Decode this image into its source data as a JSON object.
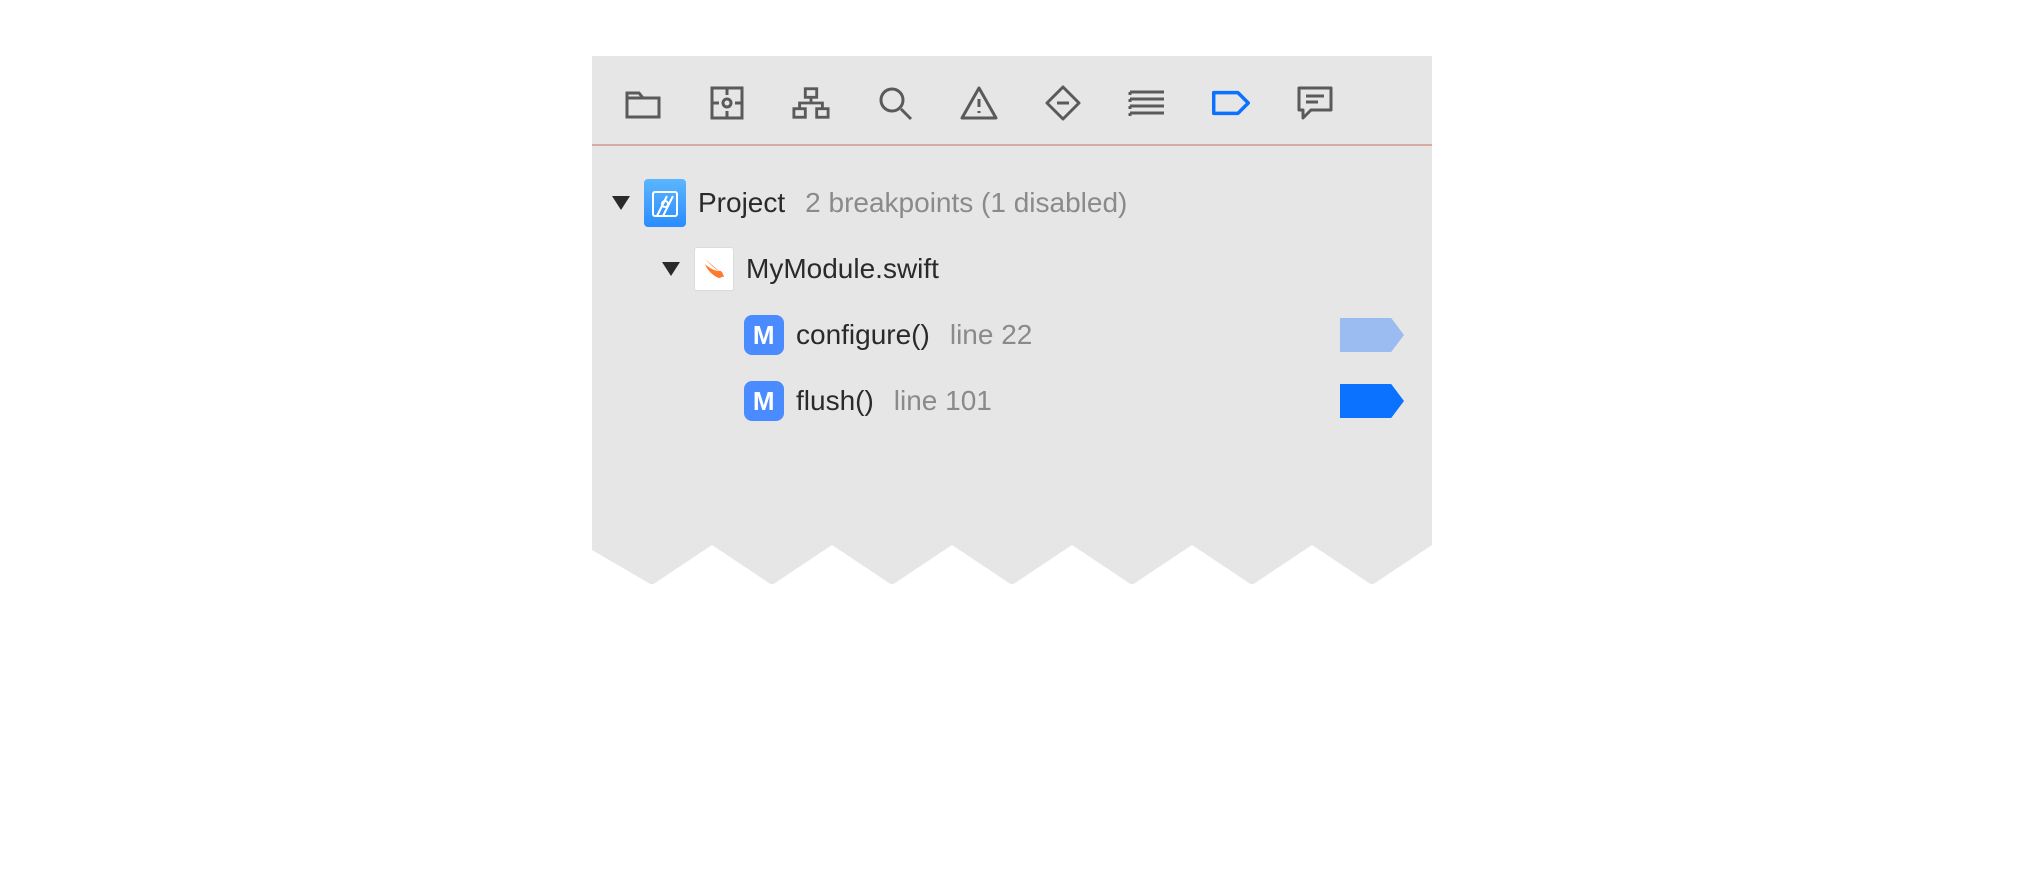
{
  "toolbar": {
    "tabs": [
      {
        "name": "project-navigator-tab",
        "icon": "folder"
      },
      {
        "name": "source-control-navigator-tab",
        "icon": "scm"
      },
      {
        "name": "symbol-navigator-tab",
        "icon": "hierarchy"
      },
      {
        "name": "find-navigator-tab",
        "icon": "search"
      },
      {
        "name": "issue-navigator-tab",
        "icon": "warning"
      },
      {
        "name": "test-navigator-tab",
        "icon": "diamond"
      },
      {
        "name": "debug-navigator-tab",
        "icon": "gauge"
      },
      {
        "name": "breakpoint-navigator-tab",
        "icon": "tag",
        "active": true
      },
      {
        "name": "report-navigator-tab",
        "icon": "chat"
      }
    ]
  },
  "tree": {
    "project": {
      "label": "Project",
      "detail": "2 breakpoints (1 disabled)"
    },
    "file": {
      "label": "MyModule.swift"
    },
    "breakpoints": [
      {
        "symbol_letter": "M",
        "func": "configure()",
        "line_label": "line 22",
        "enabled": false
      },
      {
        "symbol_letter": "M",
        "func": "flush()",
        "line_label": "line 101",
        "enabled": true
      }
    ]
  }
}
